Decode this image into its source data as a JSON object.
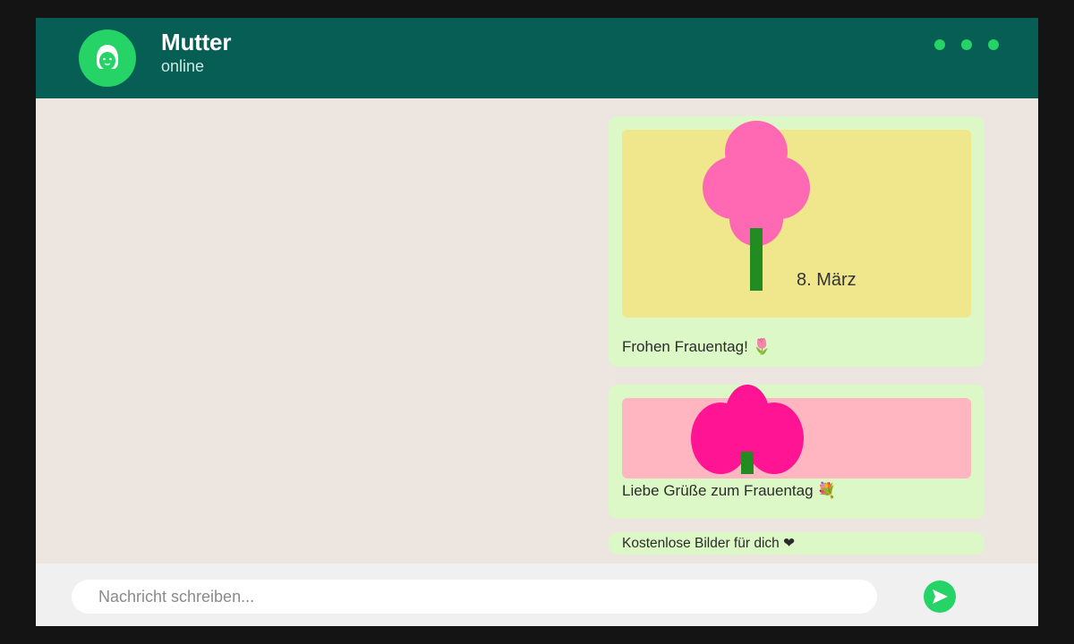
{
  "header": {
    "contact_name": "Mutter",
    "status": "online",
    "menu_icon": "more-dots-icon"
  },
  "colors": {
    "header_bg": "#075e54",
    "accent": "#25d366",
    "chat_bg": "#ede5e0",
    "bubble_bg": "#dcf8c6",
    "card1_bg": "#f0e68c",
    "card2_bg": "#ffb6c1",
    "flower1": "#ff69b4",
    "flower2": "#ff1493",
    "stem": "#228b22"
  },
  "messages": [
    {
      "card_text": "8. März",
      "caption": "Frohen Frauentag! 🌷"
    },
    {
      "caption": "Liebe Grüße zum Frauentag 💐"
    },
    {
      "caption": "Kostenlose Bilder für dich ❤"
    }
  ],
  "composer": {
    "placeholder": "Nachricht schreiben...",
    "send_icon": "send-arrow-icon"
  }
}
